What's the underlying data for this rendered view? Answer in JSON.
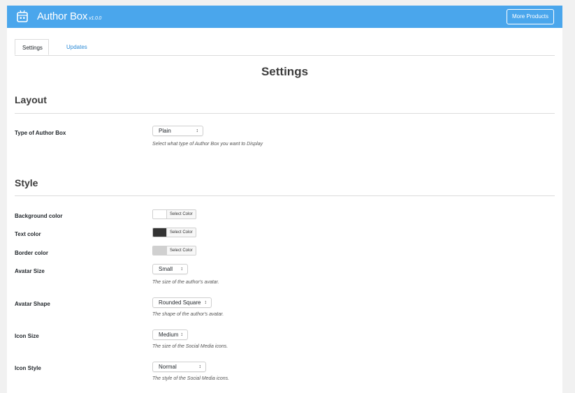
{
  "header": {
    "title": "Author Box",
    "version": "v1.0.0",
    "more_products_label": "More Products",
    "bg_color": "#4aa6ec"
  },
  "tabs": [
    {
      "label": "Settings",
      "active": true
    },
    {
      "label": "Updates",
      "active": false
    }
  ],
  "page_title": "Settings",
  "layout_section": {
    "title": "Layout",
    "type_of_box": {
      "label": "Type of Author Box",
      "value": "Plain",
      "description": "Select what type of Author Box you want to Display"
    }
  },
  "style_section": {
    "title": "Style",
    "background_color": {
      "label": "Background color",
      "button": "Select Color",
      "swatch": "#ffffff"
    },
    "text_color": {
      "label": "Text color",
      "button": "Select Color",
      "swatch": "#333333"
    },
    "border_color": {
      "label": "Border color",
      "button": "Select Color",
      "swatch": "#d0d0d0"
    },
    "avatar_size": {
      "label": "Avatar Size",
      "value": "Small",
      "description": "The size of the author's avatar."
    },
    "avatar_shape": {
      "label": "Avatar Shape",
      "value": "Rounded Square",
      "description": "The shape of the author's avatar."
    },
    "icon_size": {
      "label": "Icon Size",
      "value": "Medium",
      "description": "The size of the Social Media icons."
    },
    "icon_style": {
      "label": "Icon Style",
      "value": "Normal",
      "description": "The style of the Social Media icons."
    }
  },
  "icons": {
    "logo": "robot-icon",
    "select_arrow": "chevron-updown-icon"
  }
}
